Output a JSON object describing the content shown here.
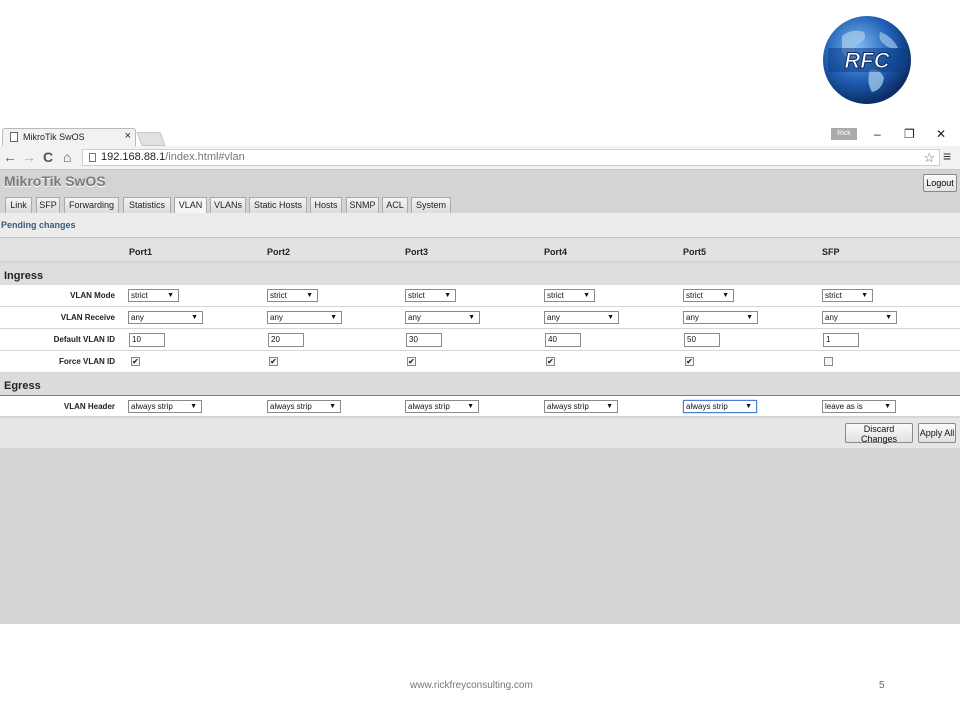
{
  "logo": {
    "text": "RFC"
  },
  "browser": {
    "tab_title": "MikroTik SwOS",
    "tab_close": "×",
    "user_badge": "Rick",
    "win_minimize": "–",
    "win_restore": "❐",
    "win_close": "✕",
    "nav_back": "←",
    "nav_forward": "→",
    "nav_reload": "C",
    "nav_home": "⌂",
    "url_host": "192.168.88.1",
    "url_path": "/index.html#vlan",
    "star": "☆",
    "menu": "≡"
  },
  "app": {
    "title": "MikroTik SwOS",
    "logout_label": "Logout",
    "tabs": [
      "Link",
      "SFP",
      "Forwarding",
      "Statistics",
      "VLAN",
      "VLANs",
      "Static Hosts",
      "Hosts",
      "SNMP",
      "ACL",
      "System"
    ],
    "active_tab": "VLAN",
    "pending": "Pending changes",
    "columns": [
      "Port1",
      "Port2",
      "Port3",
      "Port4",
      "Port5",
      "SFP"
    ],
    "ingress_title": "Ingress",
    "egress_title": "Egress",
    "rows": {
      "vlan_mode": {
        "label": "VLAN Mode",
        "values": [
          "strict",
          "strict",
          "strict",
          "strict",
          "strict",
          "strict"
        ]
      },
      "vlan_receive": {
        "label": "VLAN Receive",
        "values": [
          "any",
          "any",
          "any",
          "any",
          "any",
          "any"
        ]
      },
      "default_vlan_id": {
        "label": "Default VLAN ID",
        "values": [
          "10",
          "20",
          "30",
          "40",
          "50",
          "1"
        ]
      },
      "force_vlan_id": {
        "label": "Force VLAN ID",
        "checked": [
          true,
          true,
          true,
          true,
          true,
          false
        ]
      },
      "vlan_header": {
        "label": "VLAN Header",
        "values": [
          "always strip",
          "always strip",
          "always strip",
          "always strip",
          "always strip",
          "leave as is"
        ]
      }
    },
    "discard_label": "Discard Changes",
    "apply_label": "Apply All"
  },
  "footer": {
    "url": "www.rickfreyconsulting.com",
    "page": "5"
  }
}
